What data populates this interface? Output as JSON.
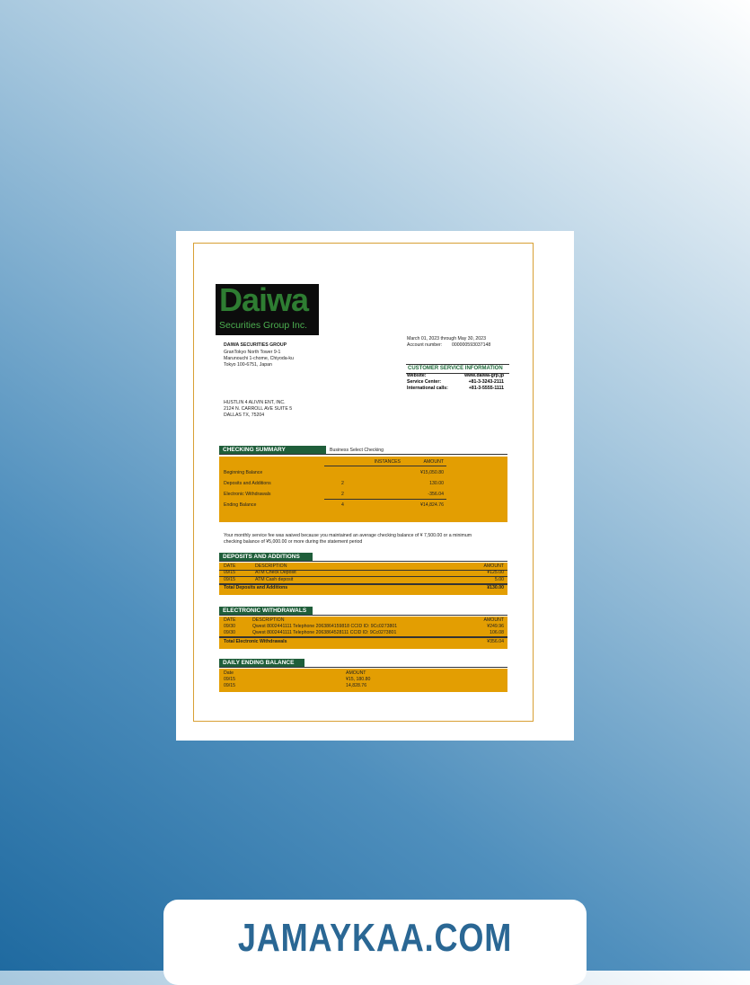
{
  "logo": {
    "word": "Daiwa",
    "sub": "Securities Group Inc."
  },
  "bank": {
    "name": "DAIWA SECURITIES GROUP",
    "lines": [
      "GranTokyo North Tower 9-1",
      "Marunouchi 1-chome, Chiyoda-ku",
      "Tokyo 100-6751, Japan"
    ]
  },
  "statement": {
    "period": "March 01, 2023 through May 30, 2023",
    "account_label": "Account number:",
    "account_number": "000000593037148"
  },
  "customer_service": {
    "title": "CUSTOMER SERVICE INFORMATION",
    "rows": [
      {
        "label": "Website:",
        "value": "www.daiwa-grp.jp"
      },
      {
        "label": "Service Center:",
        "value": "+81-3-3243-2111"
      },
      {
        "label": "International calls:",
        "value": "+81-3-5555-1111"
      }
    ]
  },
  "customer": {
    "lines": [
      "HUSTLIN 4 ALIVIN ENT, INC.",
      "2124 N. CARROLL AVE SUITE 5",
      "DALLAS TX, 75204"
    ]
  },
  "checking_summary": {
    "title": "CHECKING SUMMARY",
    "product": "Business Select Checking",
    "headers": {
      "instances": "INSTANCES",
      "amount": "AMOUNT"
    },
    "rows": [
      {
        "label": "Beginning Balance",
        "instances": "",
        "amount": "¥15,050.80"
      },
      {
        "label": "Deposits and Additions",
        "instances": "2",
        "amount": "130.00"
      },
      {
        "label": "Electronic Withdrawals",
        "instances": "2",
        "amount": "-356.04"
      },
      {
        "label": "Ending Balance",
        "instances": "4",
        "amount": "¥14,824.76"
      }
    ]
  },
  "notice": {
    "line1": "Your monthly service fee was waived because you maintained an average checking balance of  ¥ 7,500.00 or a minimum",
    "line2": "checking balance of ¥5,000.00 or more during the statement period"
  },
  "deposits": {
    "title": "DEPOSITS AND ADDITIONS",
    "headers": {
      "date": "DATE",
      "description": "DESCRIPTION",
      "amount": "AMOUNT"
    },
    "rows": [
      {
        "date": "09/15",
        "description": "ATM  Check Deposit",
        "amount": "¥125.00"
      },
      {
        "date": "09/15",
        "description": "ATM Cash deposit",
        "amount": "5.00"
      }
    ],
    "total_label": "Total Deposits and Additions",
    "total": "¥130.00"
  },
  "withdrawals": {
    "title": "ELECTRONIC WITHDRAWALS",
    "headers": {
      "date": "DATE",
      "description": "DESCRIPTION",
      "amount": "AMOUNT"
    },
    "rows": [
      {
        "date": "09/30",
        "description": "Qwest 8002441111 Telephone 2063864159818 CCID ID: 9Cc0273801",
        "amount": "¥249.96"
      },
      {
        "date": "09/30",
        "description": "Qwest 8002441111 Telephone 2063864528111 CCID ID: 9Cc0273801",
        "amount": "106.08"
      }
    ],
    "total_label": "Total Electronic Withdrawals",
    "total": "¥356.04"
  },
  "daily": {
    "title": "DAILY ENDING BALANCE",
    "headers": {
      "date": "Date",
      "amount": "AMOUNT"
    },
    "rows": [
      {
        "date": "09/15",
        "amount": "¥15, 180.80"
      },
      {
        "date": "09/15",
        "amount": "14,828.76"
      }
    ]
  },
  "watermark": "JAMAYKAA.COM"
}
